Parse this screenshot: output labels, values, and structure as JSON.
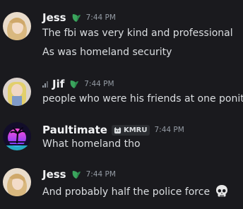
{
  "messages": [
    {
      "author": "Jess",
      "timestamp": "7:44 PM",
      "badge_icon": "leaf-icon",
      "lines": [
        "The fbi was very kind and professional",
        "As was homeland security"
      ]
    },
    {
      "author": "Jif",
      "timestamp": "7:44 PM",
      "status_icon": "signal-bars-icon",
      "badge_icon": "leaf-icon",
      "lines": [
        "people who were his friends at one ponit"
      ]
    },
    {
      "author": "Paultimate",
      "timestamp": "7:44 PM",
      "tag": "KMRU",
      "tag_icon": "cat-face-icon",
      "lines": [
        "What homeland tho"
      ]
    },
    {
      "author": "Jess",
      "timestamp": "7:44 PM",
      "badge_icon": "leaf-icon",
      "lines": [
        "And probably half the police force"
      ],
      "emoji": "skull-emoji"
    }
  ],
  "colors": {
    "background": "#1a1a1e",
    "leaf_badge": "#3ba55d",
    "username": "#f2f3f5",
    "timestamp": "#949ba4"
  }
}
